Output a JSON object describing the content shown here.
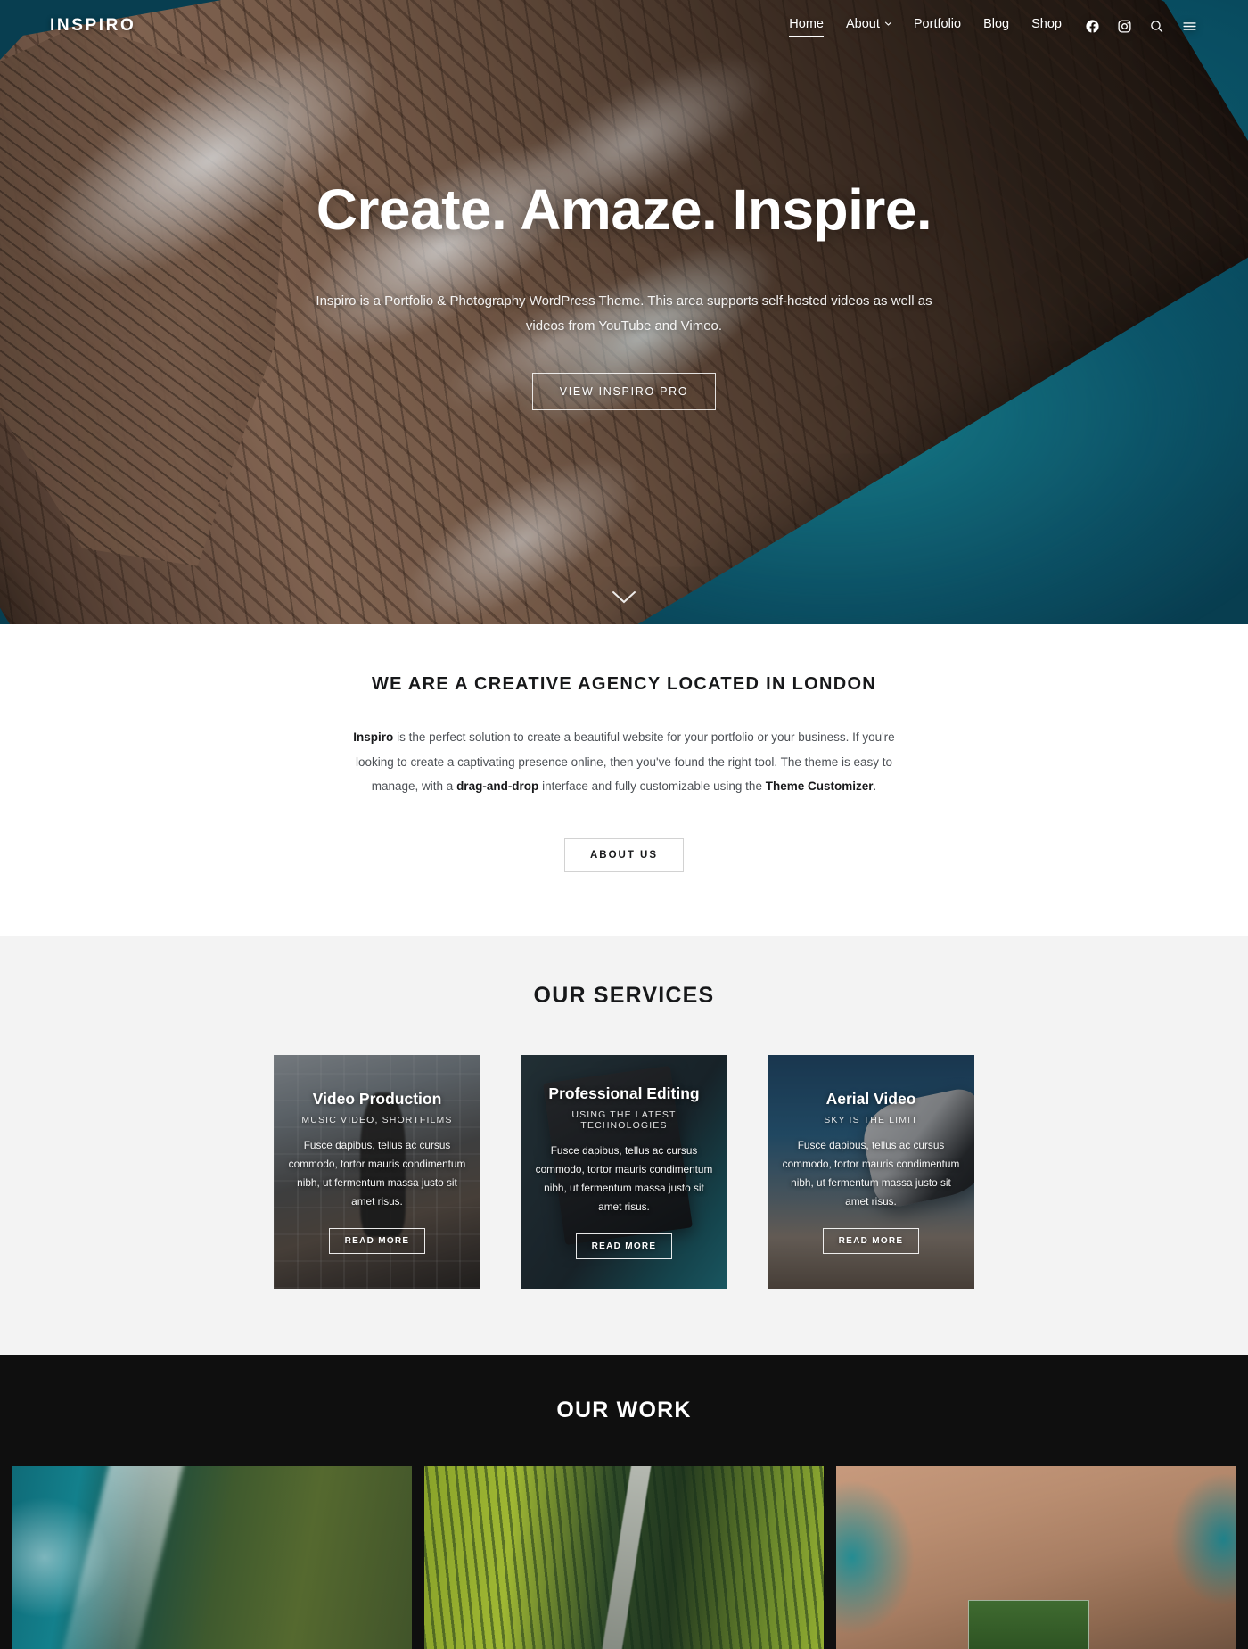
{
  "header": {
    "logo": "INSPIRO",
    "nav_items": [
      {
        "label": "Home",
        "active": true,
        "has_dropdown": false
      },
      {
        "label": "About",
        "active": false,
        "has_dropdown": true
      },
      {
        "label": "Portfolio",
        "active": false,
        "has_dropdown": false
      },
      {
        "label": "Blog",
        "active": false,
        "has_dropdown": false
      },
      {
        "label": "Shop",
        "active": false,
        "has_dropdown": false
      }
    ],
    "icons": [
      {
        "name": "facebook-icon"
      },
      {
        "name": "instagram-icon"
      },
      {
        "name": "search-icon"
      },
      {
        "name": "menu-icon"
      }
    ]
  },
  "hero": {
    "title": "Create. Amaze. Inspire.",
    "subtitle": "Inspiro is a Portfolio & Photography WordPress Theme. This area supports self-hosted videos as well as videos from YouTube and Vimeo.",
    "button_label": "VIEW INSPIRO PRO",
    "scroll_icon": "chevron-down-icon"
  },
  "intro": {
    "title": "WE ARE A CREATIVE AGENCY LOCATED IN LONDON",
    "paragraph_parts": {
      "b1": "Inspiro",
      "t1": " is the perfect solution to create a beautiful website for your portfolio or your business. If you're looking to create a captivating presence online, then you've found the right tool. The theme is easy to manage, with a ",
      "b2": "drag-and-drop",
      "t2": " interface and fully customizable using the ",
      "b3": "Theme Customizer",
      "t3": "."
    },
    "button_label": "ABOUT US"
  },
  "services": {
    "title": "OUR SERVICES",
    "cards": [
      {
        "title": "Video Production",
        "subtitle": "MUSIC VIDEO, SHORTFILMS",
        "text": "Fusce dapibus, tellus ac cursus commodo, tortor mauris condimentum nibh, ut fermentum massa justo sit amet risus.",
        "button_label": "READ MORE"
      },
      {
        "title": "Professional Editing",
        "subtitle": "USING THE LATEST TECHNOLOGIES",
        "text": "Fusce dapibus, tellus ac cursus commodo, tortor mauris condimentum nibh, ut fermentum massa justo sit amet risus.",
        "button_label": "READ MORE"
      },
      {
        "title": "Aerial Video",
        "subtitle": "SKY IS THE LIMIT",
        "text": "Fusce dapibus, tellus ac cursus commodo, tortor mauris condimentum nibh, ut fermentum massa justo sit amet risus.",
        "button_label": "READ MORE"
      }
    ]
  },
  "work": {
    "title": "OUR WORK",
    "items": [
      {
        "name": "aerial-coastline-photo"
      },
      {
        "name": "aerial-forest-road-photo"
      },
      {
        "name": "aerial-rocky-coast-photo"
      }
    ]
  },
  "colors": {
    "hero_overlay": "#000000",
    "intro_bg": "#ffffff",
    "services_bg": "#f3f3f3",
    "work_bg": "#0f0f0f",
    "text_dark": "#17181a",
    "text_body": "#4c5055"
  }
}
